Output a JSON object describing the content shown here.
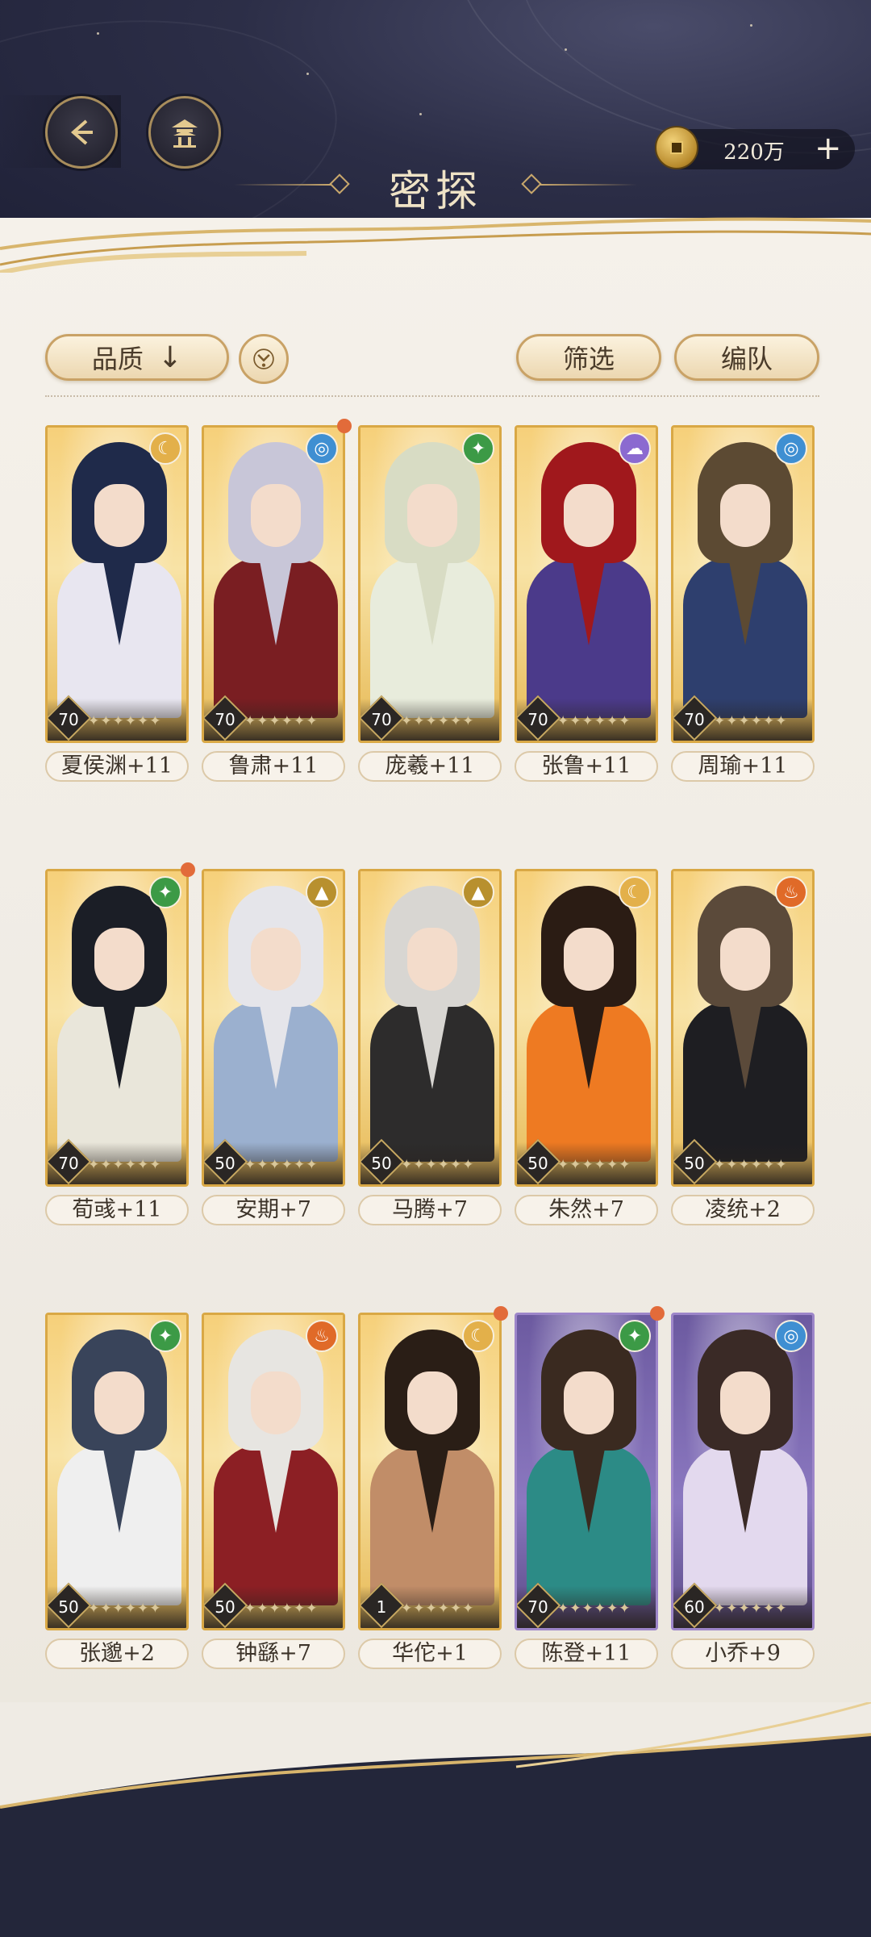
{
  "header": {
    "title": "密探",
    "currency": {
      "amount": "220万",
      "plus": "+"
    }
  },
  "toolbar": {
    "sort_label": "品质",
    "sort_arrow": "↓",
    "filter_label": "筛选",
    "team_label": "编队"
  },
  "colors": {
    "gold_border": "#d9a845",
    "purple_border": "#9d86c9",
    "panel_bg": "#f2eee7",
    "notice_dot": "#e26b3a"
  },
  "cards": [
    {
      "name": "夏侯渊+11",
      "level": "70",
      "element": "moon-icon",
      "notice": false
    },
    {
      "name": "鲁肃+11",
      "level": "70",
      "element": "water-icon",
      "notice": true
    },
    {
      "name": "庞羲+11",
      "level": "70",
      "element": "wind-icon",
      "notice": false
    },
    {
      "name": "张鲁+11",
      "level": "70",
      "element": "cloud-icon",
      "notice": false
    },
    {
      "name": "周瑜+11",
      "level": "70",
      "element": "water-icon",
      "notice": false
    },
    {
      "name": "荀彧+11",
      "level": "70",
      "element": "wind-icon",
      "notice": true
    },
    {
      "name": "安期+7",
      "level": "50",
      "element": "mountain-icon",
      "notice": false
    },
    {
      "name": "马腾+7",
      "level": "50",
      "element": "mountain-icon",
      "notice": false
    },
    {
      "name": "朱然+7",
      "level": "50",
      "element": "moon-icon",
      "notice": false
    },
    {
      "name": "凌统+2",
      "level": "50",
      "element": "fire-icon",
      "notice": false
    },
    {
      "name": "张邈+2",
      "level": "50",
      "element": "wind-icon",
      "notice": false
    },
    {
      "name": "钟繇+7",
      "level": "50",
      "element": "fire-icon",
      "notice": false
    },
    {
      "name": "华佗+1",
      "level": "1",
      "element": "moon-icon",
      "notice": true
    },
    {
      "name": "陈登+11",
      "level": "70",
      "element": "wind-icon",
      "notice": true
    },
    {
      "name": "小乔+9",
      "level": "60",
      "element": "water-icon",
      "notice": false
    }
  ]
}
